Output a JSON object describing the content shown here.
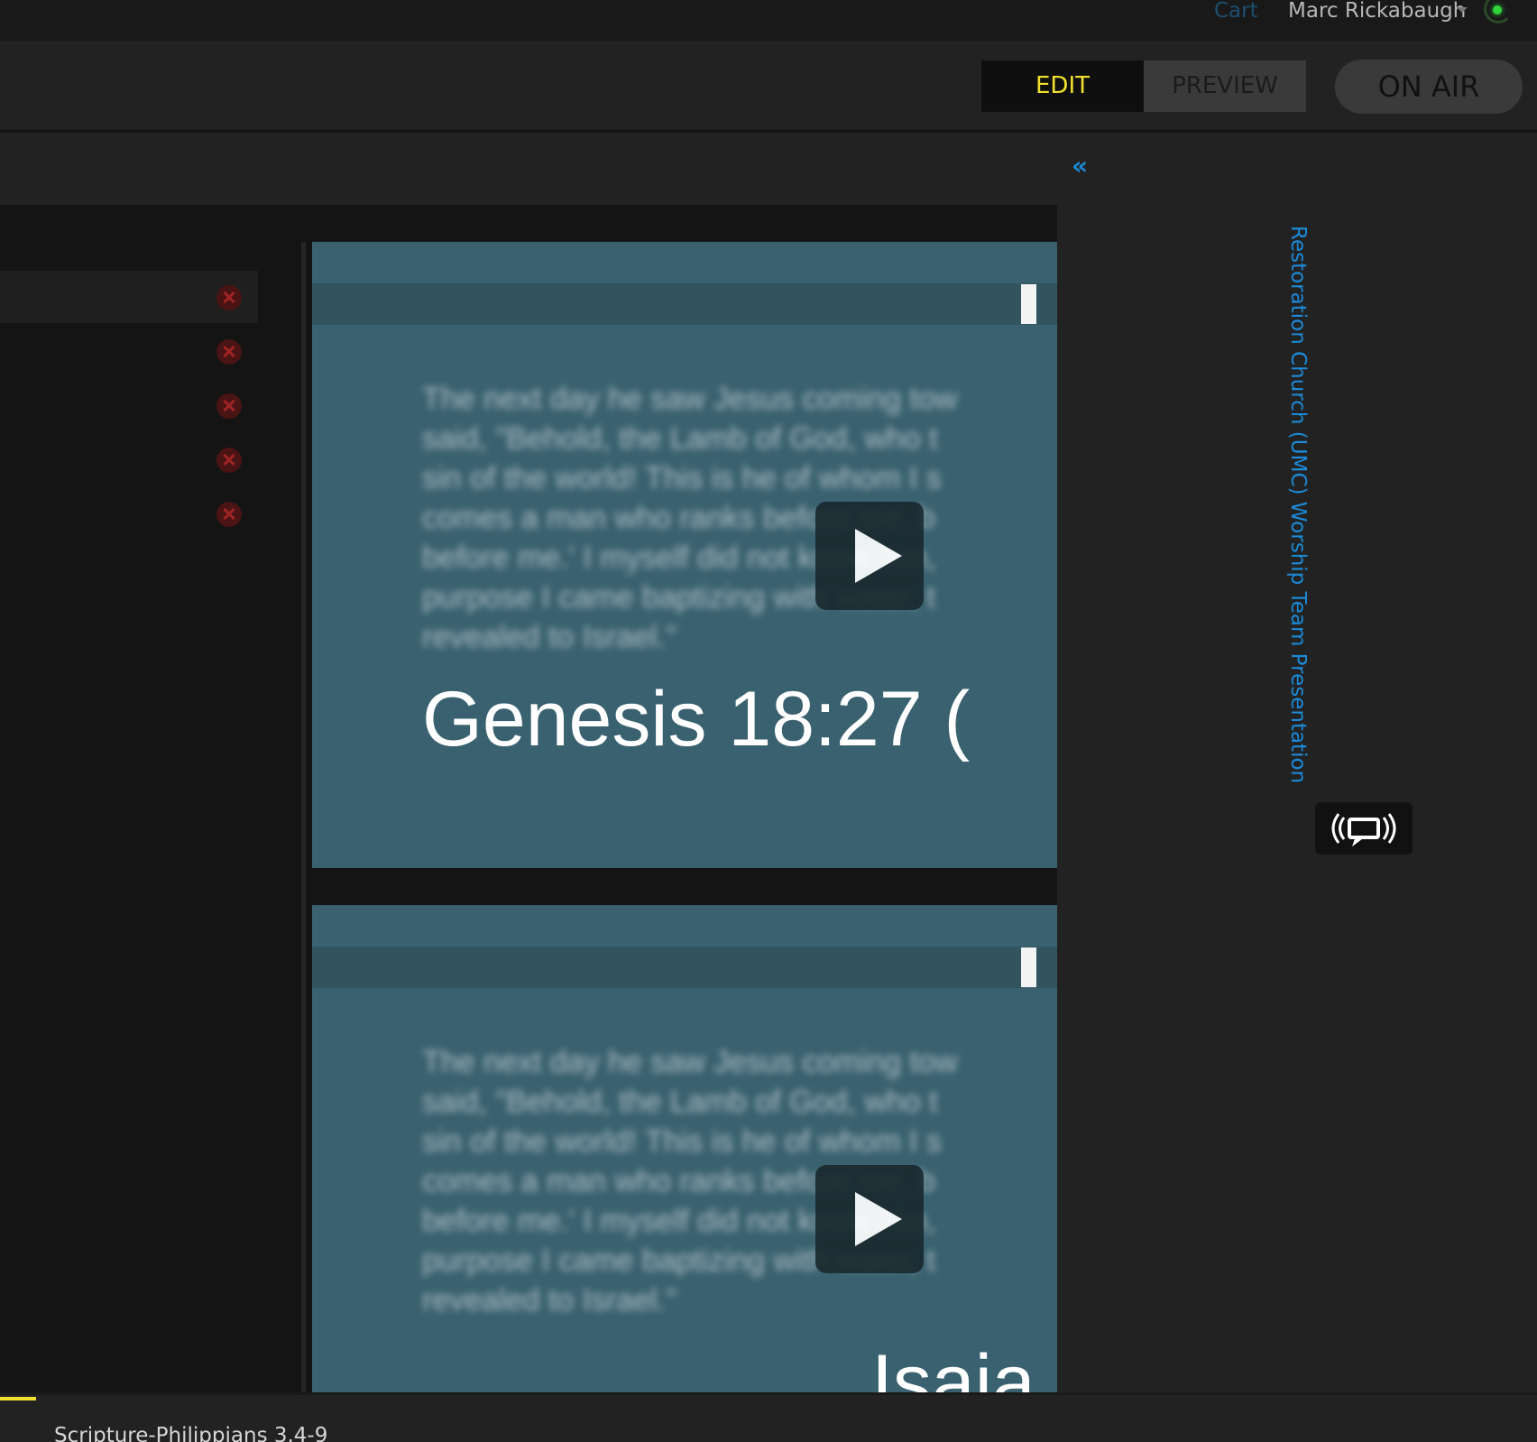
{
  "topbar": {
    "cart_label": "Cart",
    "user_name": "Marc Rickabaugh"
  },
  "modebar": {
    "edit_label": "EDIT",
    "preview_label": "PREVIEW",
    "on_air_label": "ON AIR",
    "active_mode": "EDIT"
  },
  "subbar": {
    "collapse_label": "«"
  },
  "slides": [
    {
      "reference": "Genesis 18:27 (",
      "body_blurred": "The next day he saw Jesus coming tow\nsaid, \"Behold, the Lamb of God, who t\nsin of the world! This is he of whom I s\ncomes a man who ranks before me, b\nbefore me.' I myself did not know him, \npurpose I came baptizing with water, t\nrevealed to Israel.\""
    },
    {
      "reference": "Isaia",
      "body_blurred": "The next day he saw Jesus coming tow\nsaid, \"Behold, the Lamb of God, who t\nsin of the world! This is he of whom I s\ncomes a man who ranks before me, b\nbefore me.' I myself did not know him, \npurpose I came baptizing with water, t\nrevealed to Israel.\""
    }
  ],
  "rightpanel": {
    "presentation_title": "Restoration Church (UMC) Worship Team Presentation"
  },
  "bottombar": {
    "current_item": "Scripture-Philippians 3.4-9"
  },
  "colors": {
    "accent_yellow": "#f1e02d",
    "link_blue": "#1c8ad8",
    "slide_bg": "#3a616f",
    "status_green": "#2fd33a",
    "remove_red": "#a12424"
  }
}
